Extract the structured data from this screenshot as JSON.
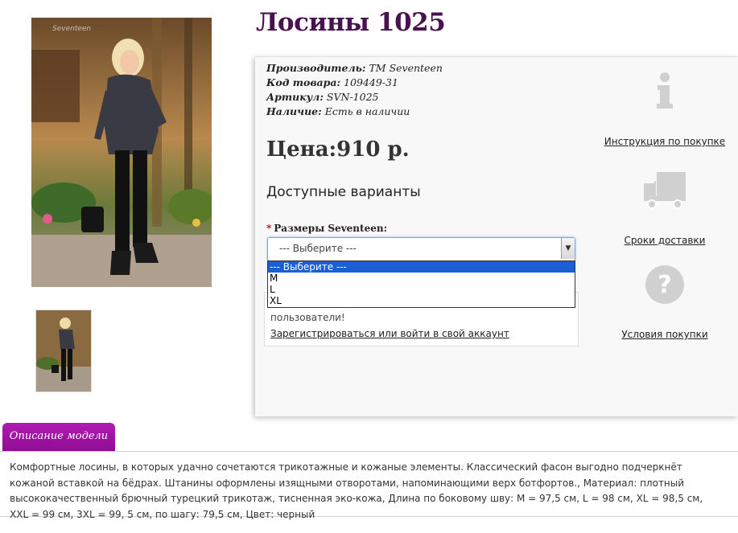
{
  "product": {
    "title": "Лосины 1025",
    "specs": [
      {
        "label": "Производитель:",
        "value": "TM Seventeen"
      },
      {
        "label": "Код товара:",
        "value": "109449-31"
      },
      {
        "label": "Артикул:",
        "value": "SVN-1025"
      },
      {
        "label": "Наличие:",
        "value": "Есть в наличии"
      }
    ],
    "price": "Цена:910 р."
  },
  "variants": {
    "heading": "Доступные варианты",
    "size_required_mark": "*",
    "size_label": "Размеры Seventeen:",
    "selected": "--- Выберите ---",
    "options": [
      "--- Выберите ---",
      "M",
      "L",
      "XL"
    ]
  },
  "notice": {
    "text": "пользователи!",
    "link": "Зарегистрироваться или войти в свой аккаунт"
  },
  "info_links": {
    "instruction": "Инструкция по покупке",
    "delivery": "Сроки доставки",
    "terms": "Условия покупки"
  },
  "description": {
    "tab_label": "Описание модели",
    "text": "Комфортные лосины, в которых удачно сочетаются трикотажные и кожаные элементы. Классический фасон выгодно подчеркнёт кожаной вставкой на бёдрах. Штанины оформлены изящными отворотами, напоминающими верх ботфортов., Материал: плотный высококачественный брючный турецкий трикотаж, тисненная эко-кожа, Длина по боковому шву: M = 97,5 см, L = 98 см, XL = 98,5 см, XXL = 99 см, 3XL = 99, 5 см, по шагу: 79,5 см, Цвет: черный"
  },
  "colors": {
    "title": "#4a1150",
    "tab": "#a514a8",
    "selected_option": "#1a5fd6"
  },
  "icons": [
    "info-icon",
    "delivery-truck-icon",
    "question-icon"
  ]
}
